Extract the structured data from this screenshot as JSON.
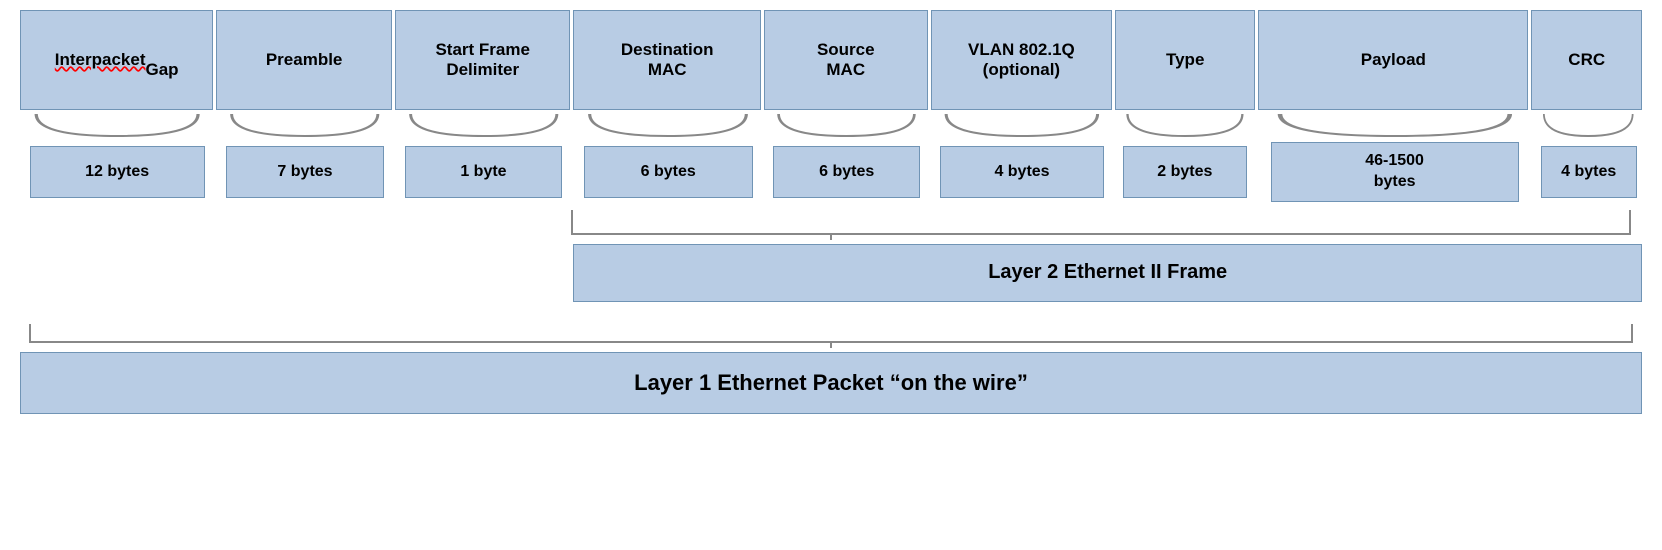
{
  "header": {
    "cells": [
      {
        "id": "interpacket-gap",
        "label": "Interpacket\nGap",
        "underline": true
      },
      {
        "id": "preamble",
        "label": "Preamble",
        "underline": false
      },
      {
        "id": "start-frame-delimiter",
        "label": "Start Frame\nDelimiter",
        "underline": false
      },
      {
        "id": "destination-mac",
        "label": "Destination\nMAC",
        "underline": false
      },
      {
        "id": "source-mac",
        "label": "Source\nMAC",
        "underline": false
      },
      {
        "id": "vlan-802-1q",
        "label": "VLAN 802.1Q\n(optional)",
        "underline": false
      },
      {
        "id": "type",
        "label": "Type",
        "underline": false
      },
      {
        "id": "payload",
        "label": "Payload",
        "underline": false
      },
      {
        "id": "crc",
        "label": "CRC",
        "underline": false
      }
    ]
  },
  "bytes": [
    "12 bytes",
    "7 bytes",
    "1 byte",
    "6 bytes",
    "6 bytes",
    "4 bytes",
    "2 bytes",
    "46-1500\nbytes",
    "4 bytes"
  ],
  "layer2": {
    "label": "Layer 2 Ethernet II Frame"
  },
  "layer1": {
    "label": "Layer 1 Ethernet Packet “on the wire”"
  }
}
